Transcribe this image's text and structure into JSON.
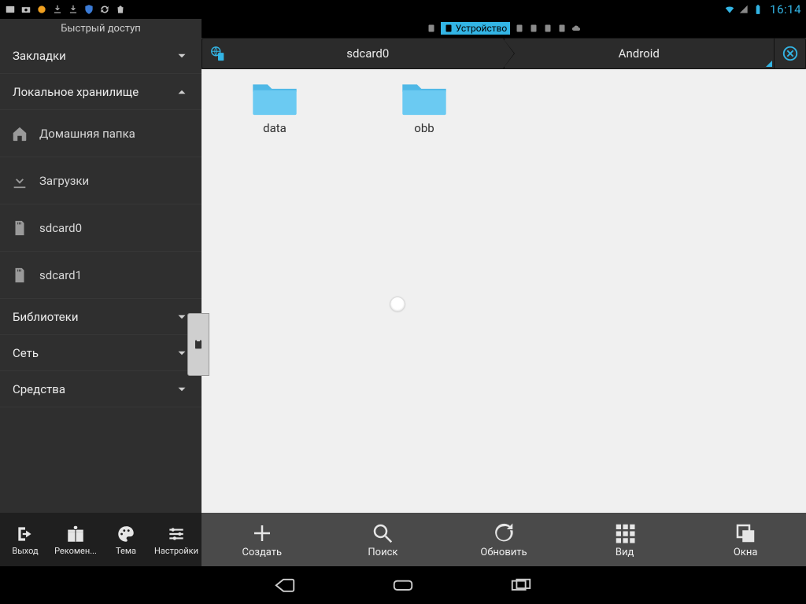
{
  "statusbar": {
    "clock": "16:14"
  },
  "sidebar": {
    "title": "Быстрый доступ",
    "sections": {
      "bookmarks": "Закладки",
      "local": "Локальное хранилище",
      "libraries": "Библиотеки",
      "network": "Сеть",
      "tools": "Средства"
    },
    "items": {
      "home": "Домашняя папка",
      "downloads": "Загрузки",
      "sdcard0": "sdcard0",
      "sdcard1": "sdcard1"
    }
  },
  "tabs": {
    "active": "Устройство"
  },
  "path": {
    "seg0": "sdcard0",
    "seg1": "Android"
  },
  "folders": {
    "data": "data",
    "obb": "obb"
  },
  "bottom_left": {
    "exit": "Выход",
    "recommend": "Рекомен...",
    "theme": "Тема",
    "settings": "Настройки"
  },
  "bottom_right": {
    "create": "Создать",
    "search": "Поиск",
    "refresh": "Обновить",
    "view": "Вид",
    "windows": "Окна"
  }
}
